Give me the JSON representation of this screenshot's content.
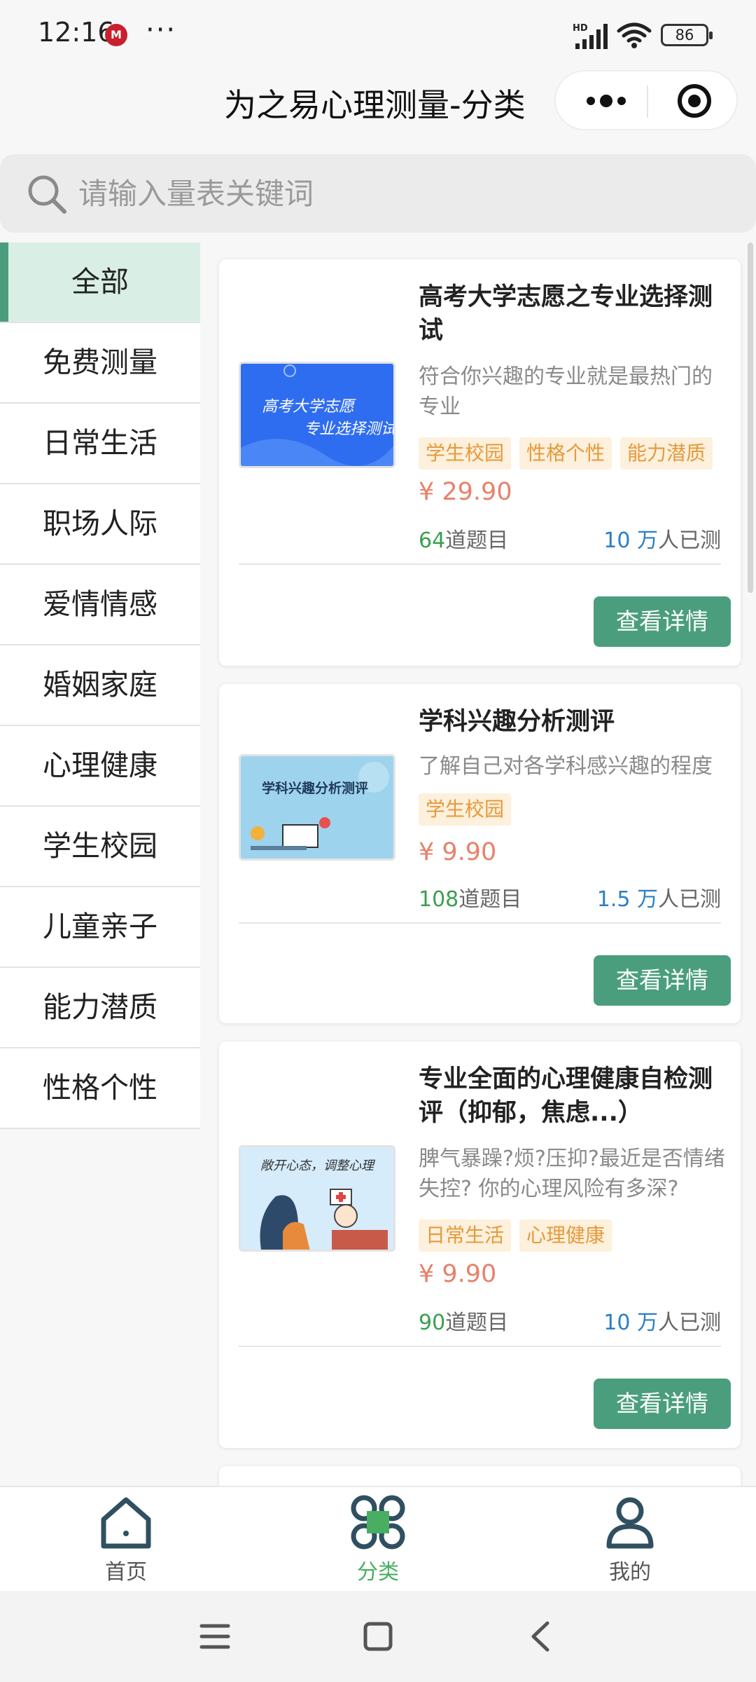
{
  "status_bar": {
    "time": "12:16",
    "app_badge": "M",
    "more": "···",
    "network": "HD",
    "battery": "86"
  },
  "header": {
    "title": "为之易心理测量-分类"
  },
  "search": {
    "placeholder": "请输入量表关键词"
  },
  "sidebar": {
    "items": [
      {
        "label": "全部",
        "active": true
      },
      {
        "label": "免费测量"
      },
      {
        "label": "日常生活"
      },
      {
        "label": "职场人际"
      },
      {
        "label": "爱情情感"
      },
      {
        "label": "婚姻家庭"
      },
      {
        "label": "心理健康"
      },
      {
        "label": "学生校园"
      },
      {
        "label": "儿童亲子"
      },
      {
        "label": "能力潜质"
      },
      {
        "label": "性格个性"
      }
    ]
  },
  "cards": [
    {
      "thumb_text": [
        "高考大学志愿",
        "专业选择测试"
      ],
      "title": "高考大学志愿之专业选择测试",
      "desc": "符合你兴趣的专业就是最热门的专业",
      "tags": [
        "学生校园",
        "性格个性",
        "能力潜质"
      ],
      "price": "¥ 29.90",
      "questions_num": "64",
      "questions_label": "道题目",
      "people_num": "10 万",
      "people_label": "人已测",
      "button": "查看详情"
    },
    {
      "thumb_text": [
        "学科兴趣分析测评"
      ],
      "title": "学科兴趣分析测评",
      "desc": "了解自己对各学科感兴趣的程度",
      "tags": [
        "学生校园"
      ],
      "price": "¥ 9.90",
      "questions_num": "108",
      "questions_label": "道题目",
      "people_num": "1.5 万",
      "people_label": "人已测",
      "button": "查看详情"
    },
    {
      "thumb_text": [
        "敞开心态，调整心理"
      ],
      "title": "专业全面的心理健康自检测评（抑郁，焦虑...）",
      "desc": "脾气暴躁?烦?压抑?最近是否情绪失控? 你的心理风险有多深?",
      "tags": [
        "日常生活",
        "心理健康"
      ],
      "price": "¥ 9.90",
      "questions_num": "90",
      "questions_label": "道题目",
      "people_num": "10 万",
      "people_label": "人已测",
      "button": "查看详情"
    }
  ],
  "tabbar": {
    "items": [
      {
        "label": "首页",
        "icon": "home-icon"
      },
      {
        "label": "分类",
        "icon": "category-icon",
        "active": true
      },
      {
        "label": "我的",
        "icon": "profile-icon"
      }
    ]
  },
  "colors": {
    "accent": "#4a9e7e",
    "tab_active": "#4aae62",
    "price": "#e8816b",
    "tag_bg": "#fdf0dc",
    "tag_text": "#e59a3b"
  }
}
